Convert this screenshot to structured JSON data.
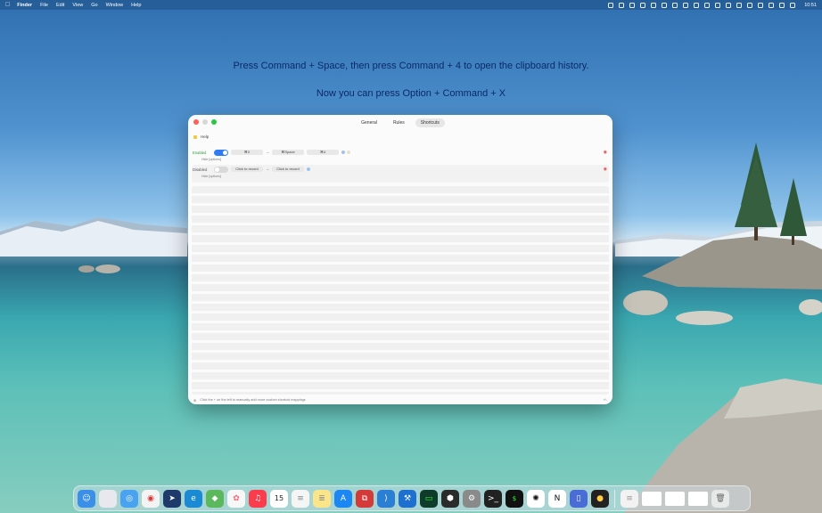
{
  "menubar": {
    "app_name": "Finder",
    "items": [
      "File",
      "Edit",
      "View",
      "Go",
      "Window",
      "Help"
    ],
    "clock": "10:51"
  },
  "instructions": {
    "line1": "Press Command + Space, then press Command + 4 to open the clipboard history.",
    "line2": "Now you can press Option + Command + X"
  },
  "window": {
    "tabs": [
      "General",
      "Rules",
      "Shortcuts"
    ],
    "active_tab": "Shortcuts",
    "help_label": "Help",
    "rows": [
      {
        "status": "Enabled",
        "from_key": "⌘X",
        "to_key1": "⌘Space",
        "to_key2": "⌘4",
        "note": "Hide [options]"
      },
      {
        "status": "Disabled",
        "from_key": "Click to record",
        "to_key1": "Click to record",
        "note": "Hide [options]"
      }
    ],
    "footer_left": "Click the + on the left to manually add more custom shortcut mappings",
    "footer_right": "+/-"
  },
  "colors": {
    "accent": "#2f7cf6",
    "enabled_text": "#2a9d3a",
    "trash": "#e05050"
  },
  "dock": {
    "icons": [
      "finder-icon",
      "launchpad-icon",
      "safari-icon",
      "chrome-icon",
      "telegram-icon",
      "edge-icon",
      "maps-icon",
      "photos-icon",
      "music-icon",
      "calendar-icon",
      "reminders-icon",
      "notes-icon",
      "appstore-icon",
      "parallels-icon",
      "vscode-icon",
      "xcode-icon",
      "terminal-green-icon",
      "cube-icon",
      "system-settings-icon",
      "terminal-icon",
      "iterm-icon",
      "chatgpt-icon",
      "notion-icon",
      "preview-icon",
      "colors-icon"
    ],
    "calendar_day": "15"
  }
}
